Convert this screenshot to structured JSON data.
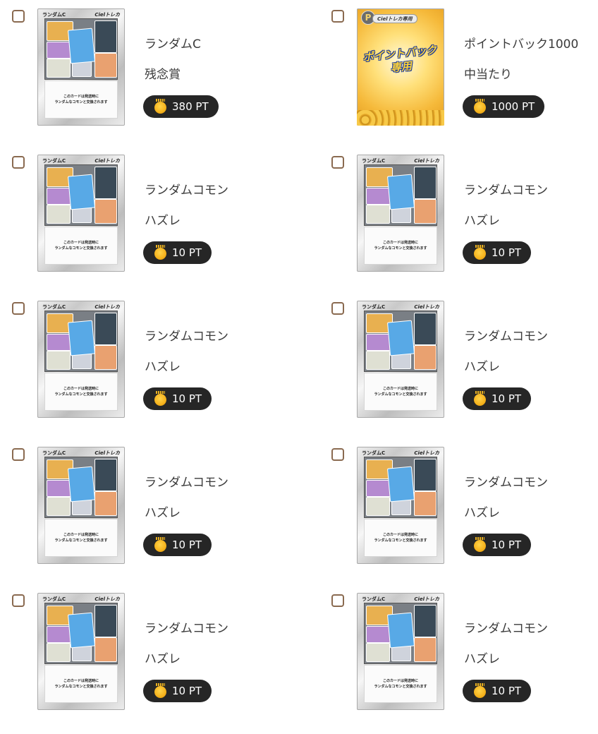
{
  "card_labels": {
    "random_header": "ランダムC",
    "random_brand": "Cielトレカ",
    "random_line1": "このカードは発送時に",
    "random_line2": "ランダムなコモンと交換されます",
    "point_logo": "P",
    "point_header": "Cielトレカ専用",
    "point_title1": "ポイントバック",
    "point_title2": "専用"
  },
  "items": [
    {
      "card": "random",
      "name": "ランダムC",
      "result": "残念賞",
      "points": "380 PT"
    },
    {
      "card": "point",
      "name": "ポイントバック1000",
      "result": "中当たり",
      "points": "1000 PT"
    },
    {
      "card": "random",
      "name": "ランダムコモン",
      "result": "ハズレ",
      "points": "10 PT"
    },
    {
      "card": "random",
      "name": "ランダムコモン",
      "result": "ハズレ",
      "points": "10 PT"
    },
    {
      "card": "random",
      "name": "ランダムコモン",
      "result": "ハズレ",
      "points": "10 PT"
    },
    {
      "card": "random",
      "name": "ランダムコモン",
      "result": "ハズレ",
      "points": "10 PT"
    },
    {
      "card": "random",
      "name": "ランダムコモン",
      "result": "ハズレ",
      "points": "10 PT"
    },
    {
      "card": "random",
      "name": "ランダムコモン",
      "result": "ハズレ",
      "points": "10 PT"
    },
    {
      "card": "random",
      "name": "ランダムコモン",
      "result": "ハズレ",
      "points": "10 PT"
    },
    {
      "card": "random",
      "name": "ランダムコモン",
      "result": "ハズレ",
      "points": "10 PT"
    }
  ],
  "icons": {
    "checkbox": "checkbox-unchecked",
    "points": "coin-icon"
  },
  "colors": {
    "checkbox_border": "#8a6a50",
    "pill_bg": "#262626",
    "coin": "#f5b21c"
  }
}
